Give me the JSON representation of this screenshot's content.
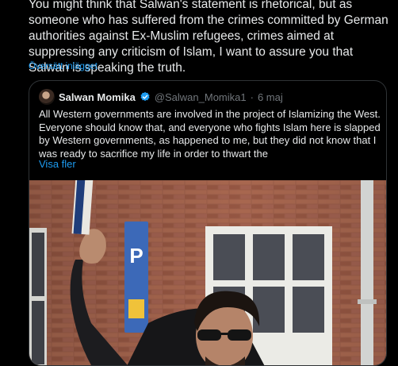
{
  "post": {
    "text": "You might think that Salwan's statement is rhetorical, but as someone who has suffered from the crimes committed by German authorities against Ex-Muslim refugees, crimes aimed at suppressing any criticism of Islam, I want to assure you that Salwan is speaking the truth.",
    "translated_label": "Översätt inlägget"
  },
  "quote": {
    "author_name": "Salwan Momika",
    "verified_icon": "verified-badge-icon",
    "handle": "@Salwan_Momika1",
    "separator": "·",
    "date": "6 maj",
    "text": "All Western governments are involved in the project of Islamizing the West. Everyone should know that, and everyone who fights Islam here is slapped by Western governments, as happened to me, but they did not know that I was ready to sacrifice my life in order to thwart the",
    "show_more_label": "Visa fler",
    "photo_sign_letter": "P"
  },
  "colors": {
    "background": "#000000",
    "text": "#e7e9ea",
    "link": "#1d9bf0",
    "muted": "#71767b",
    "border": "#2f3336",
    "verified": "#1d9bf0"
  }
}
